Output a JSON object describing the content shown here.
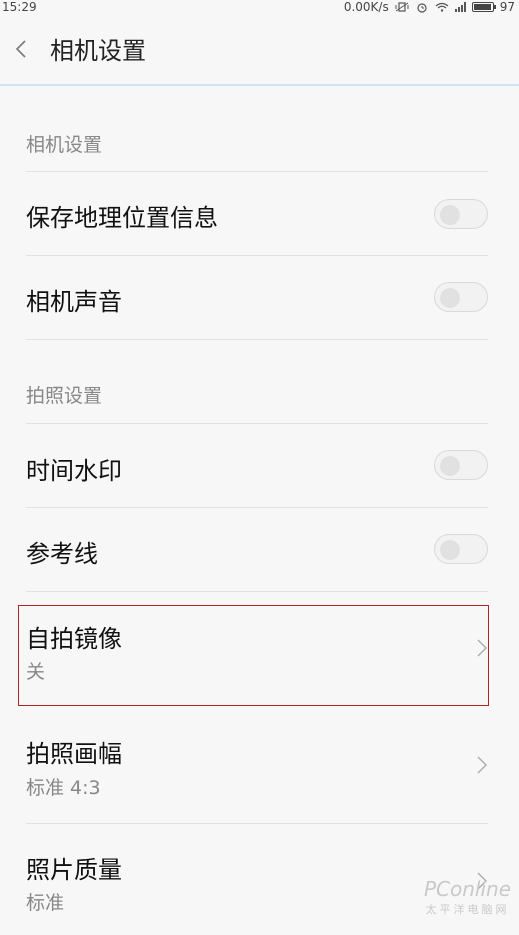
{
  "status_bar": {
    "time": "15:29",
    "speed": "0.00K/s",
    "battery": "97",
    "battery_level": 0.97
  },
  "header": {
    "title": "相机设置"
  },
  "sections": {
    "camera": {
      "title": "相机设置",
      "items": [
        {
          "label": "保存地理位置信息",
          "type": "toggle",
          "on": false
        },
        {
          "label": "相机声音",
          "type": "toggle",
          "on": false
        }
      ]
    },
    "photo": {
      "title": "拍照设置",
      "items": [
        {
          "label": "时间水印",
          "type": "toggle",
          "on": false
        },
        {
          "label": "参考线",
          "type": "toggle",
          "on": false
        },
        {
          "label": "自拍镜像",
          "value": "关",
          "type": "link"
        },
        {
          "label": "拍照画幅",
          "value": "标准 4:3",
          "type": "link"
        },
        {
          "label": "照片质量",
          "value": "标准",
          "type": "link"
        }
      ]
    }
  },
  "watermark": {
    "brand": "PConline",
    "tagline": "太平洋电脑网"
  }
}
